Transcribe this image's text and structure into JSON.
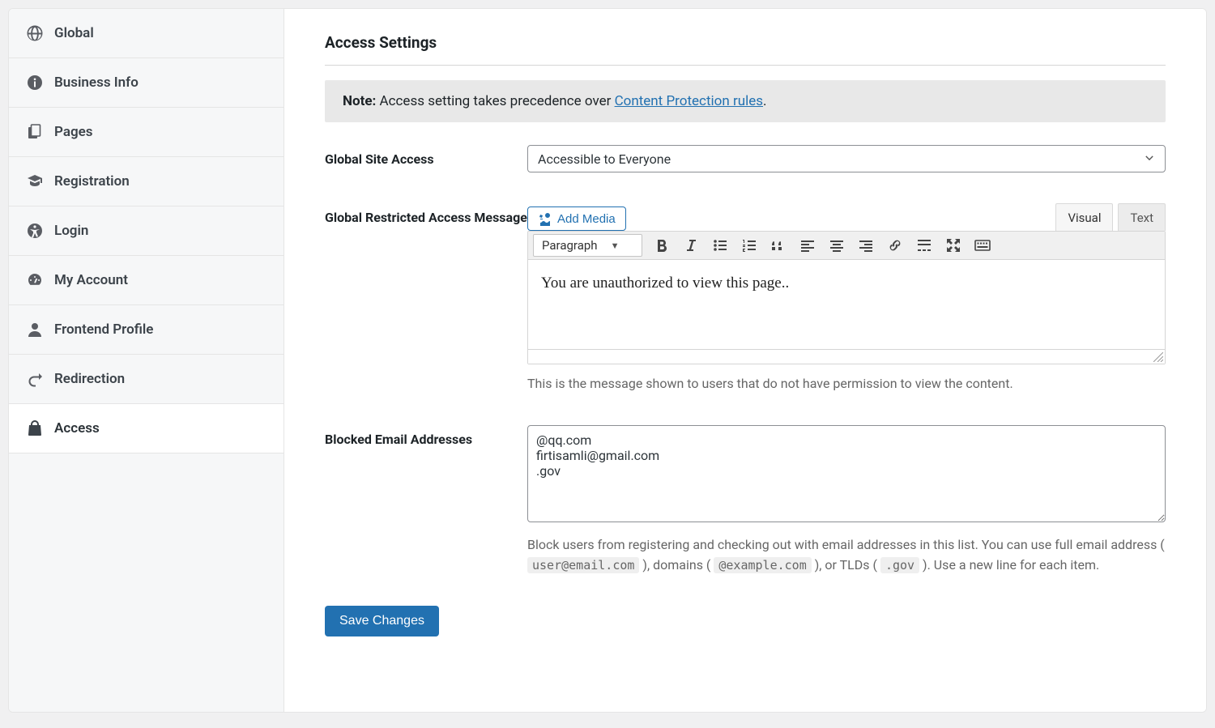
{
  "sidebar": {
    "items": [
      {
        "label": "Global",
        "icon": "globe-icon"
      },
      {
        "label": "Business Info",
        "icon": "info-icon"
      },
      {
        "label": "Pages",
        "icon": "pages-icon"
      },
      {
        "label": "Registration",
        "icon": "grad-cap-icon"
      },
      {
        "label": "Login",
        "icon": "accessibility-icon"
      },
      {
        "label": "My Account",
        "icon": "dashboard-icon"
      },
      {
        "label": "Frontend Profile",
        "icon": "user-icon"
      },
      {
        "label": "Redirection",
        "icon": "redirect-icon"
      },
      {
        "label": "Access",
        "icon": "bag-icon"
      }
    ],
    "active_index": 8
  },
  "page": {
    "title": "Access Settings",
    "note_label": "Note:",
    "note_text": "Access setting takes precedence over ",
    "note_link_text": "Content Protection rules",
    "note_tail": "."
  },
  "global_access": {
    "label": "Global Site Access",
    "value": "Accessible to Everyone"
  },
  "restricted_msg": {
    "label": "Global Restricted Access Message",
    "add_media_label": "Add Media",
    "tab_visual": "Visual",
    "tab_text": "Text",
    "format_dropdown": "Paragraph",
    "content": "You are unauthorized to view this page..",
    "help": "This is the message shown to users that do not have permission to view the content."
  },
  "blocked_emails": {
    "label": "Blocked Email Addresses",
    "value": "@qq.com\nfirtisamli@gmail.com\n.gov",
    "help_before": "Block users from registering and checking out with email addresses in this list. You can use full email address ( ",
    "help_code1": "user@email.com",
    "help_mid1": " ), domains ( ",
    "help_code2": "@example.com",
    "help_mid2": " ), or TLDs ( ",
    "help_code3": ".gov",
    "help_after": " ). Use a new line for each item."
  },
  "save_label": "Save Changes",
  "colors": {
    "accent": "#2271b1"
  }
}
